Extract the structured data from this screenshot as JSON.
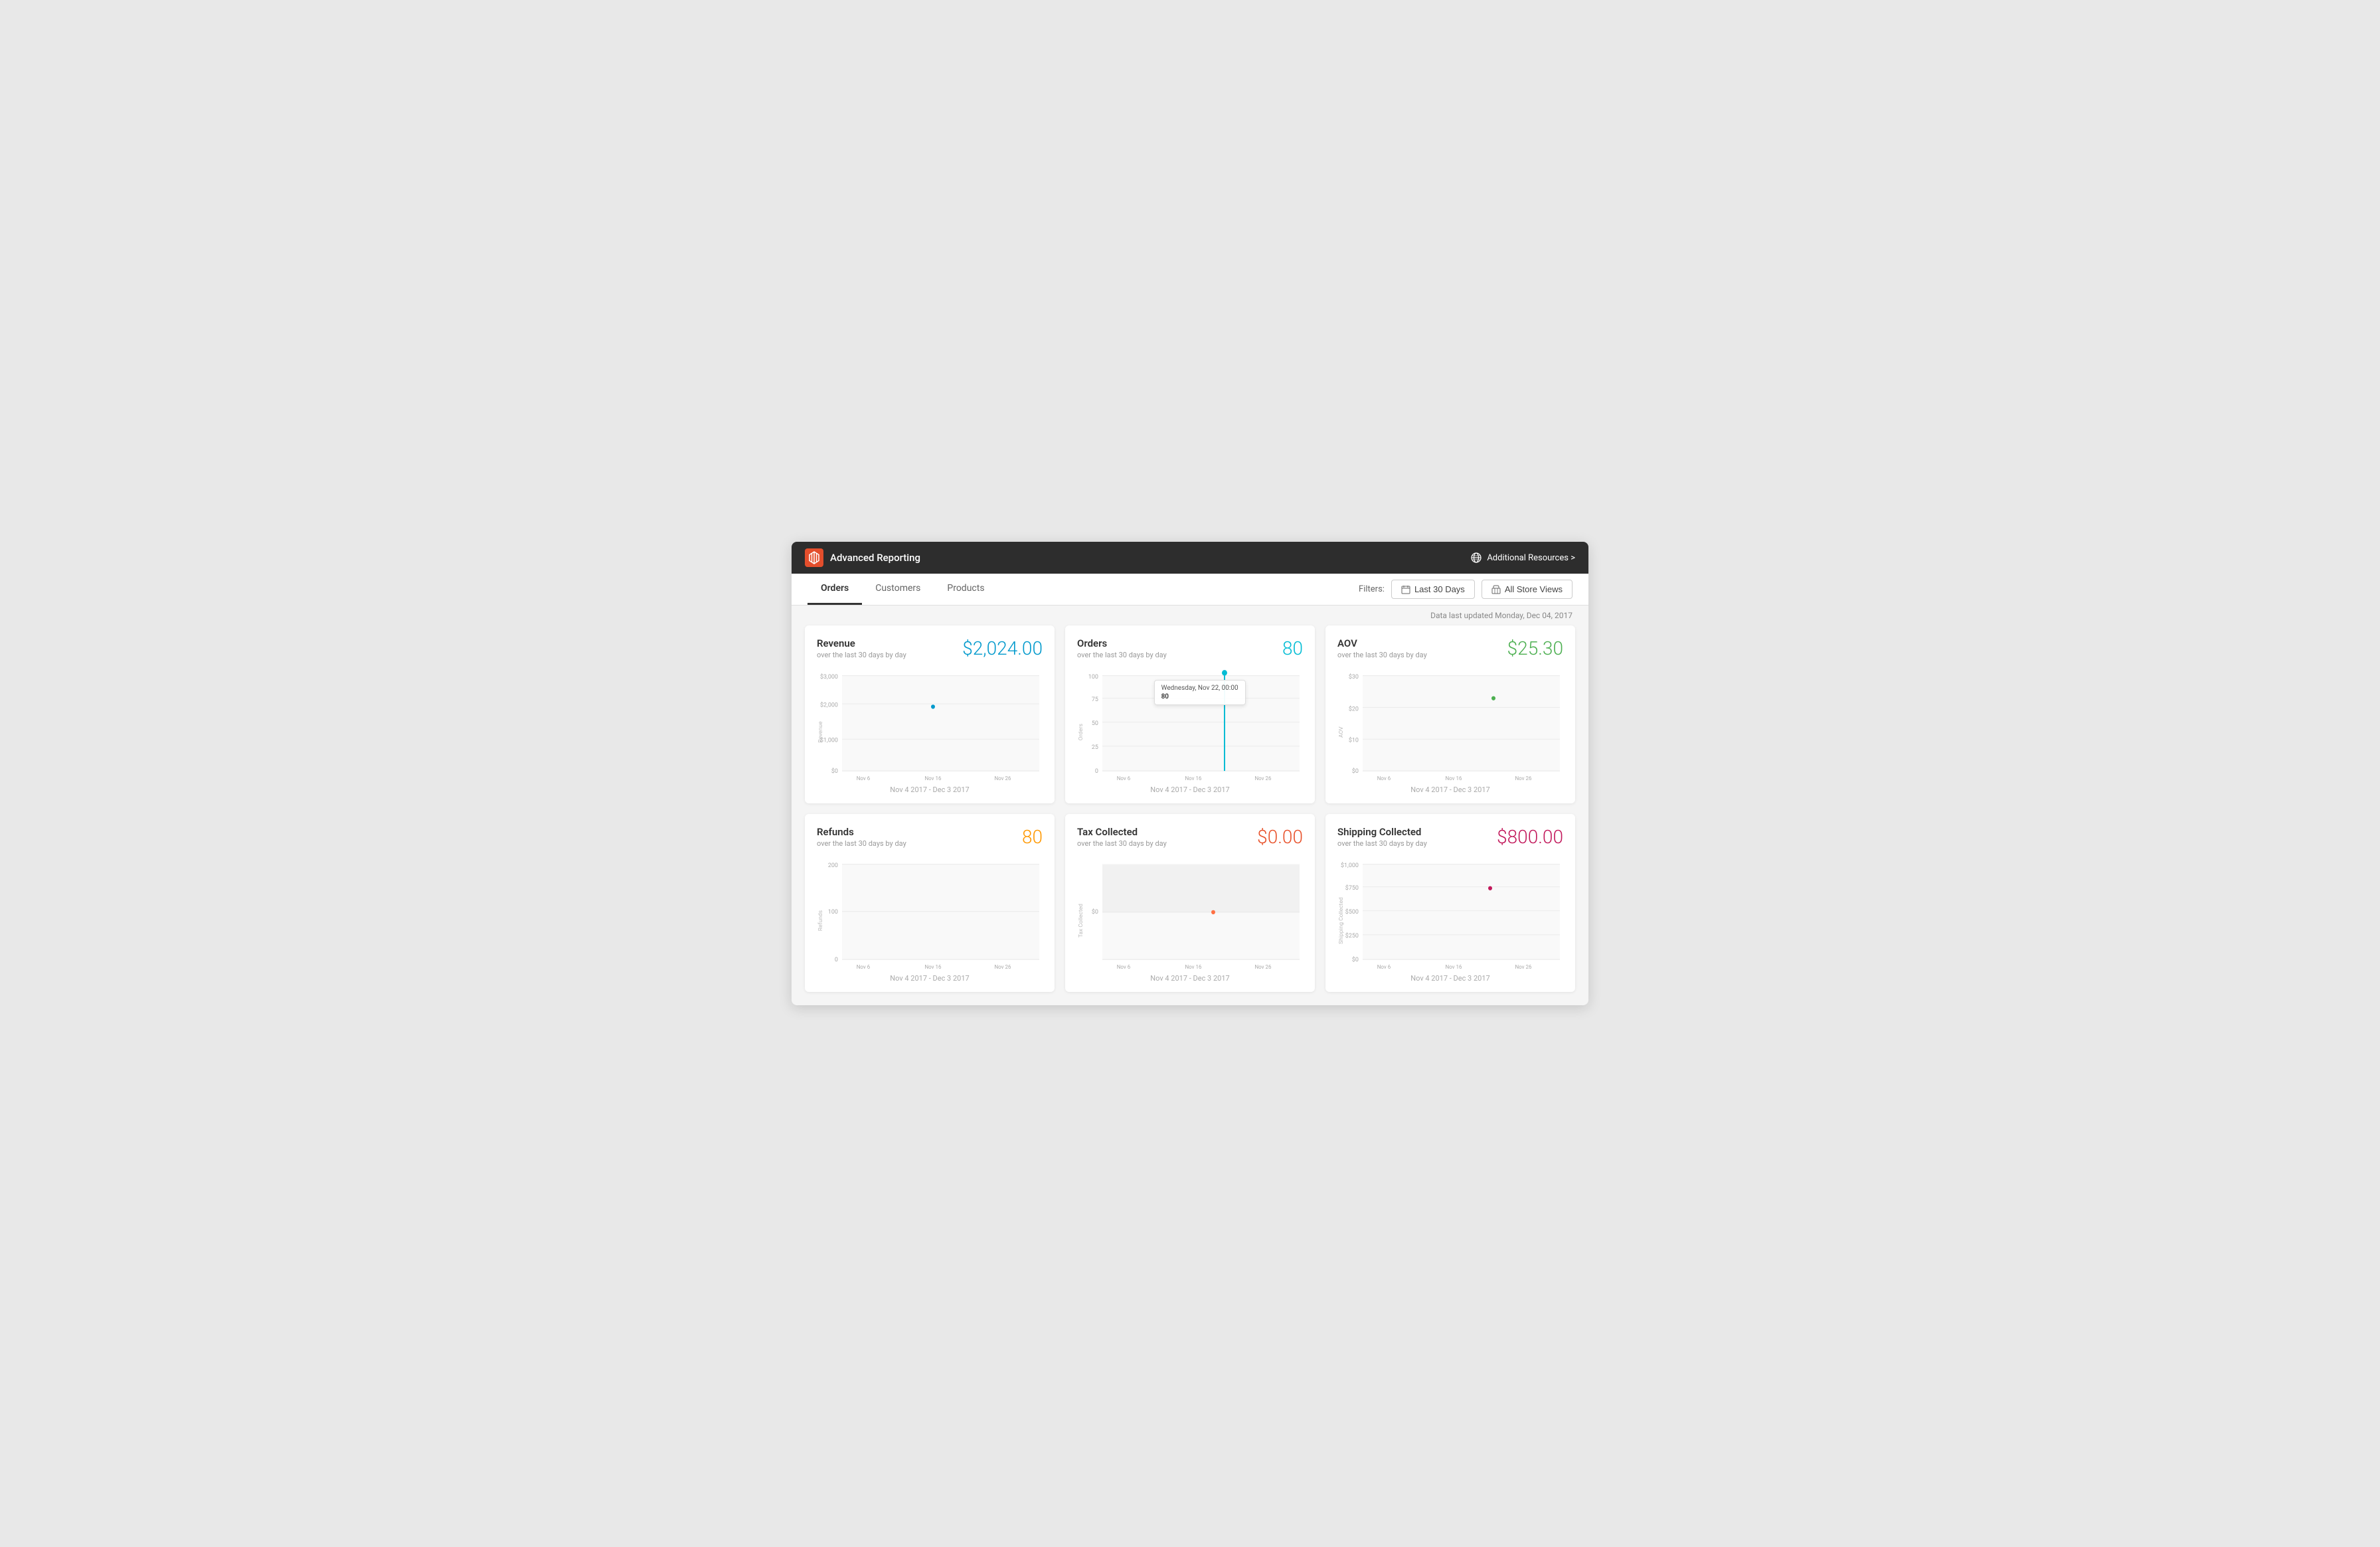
{
  "header": {
    "title": "Advanced Reporting",
    "additional_resources_label": "Additional Resources >"
  },
  "nav": {
    "tabs": [
      {
        "label": "Orders",
        "active": true
      },
      {
        "label": "Customers",
        "active": false
      },
      {
        "label": "Products",
        "active": false
      }
    ],
    "filters_label": "Filters:",
    "filter_date_label": "Last 30 Days",
    "filter_store_label": "All Store Views"
  },
  "data_updated": "Data last updated Monday, Dec 04, 2017",
  "cards": [
    {
      "id": "revenue",
      "title": "Revenue",
      "subtitle": "over the last 30 days by day",
      "value": "$2,024.00",
      "value_color": "value-blue",
      "date_range": "Nov 4 2017 - Dec 3 2017",
      "y_axis": [
        "$3,000",
        "$2,000",
        "$1,000",
        "$0"
      ],
      "x_axis": [
        "Nov 6",
        "Nov 16",
        "Nov 26"
      ]
    },
    {
      "id": "orders",
      "title": "Orders",
      "subtitle": "over the last 30 days by day",
      "value": "80",
      "value_color": "value-teal",
      "date_range": "Nov 4 2017 - Dec 3 2017",
      "y_axis": [
        "100",
        "75",
        "50",
        "25",
        "0"
      ],
      "x_axis": [
        "Nov 6",
        "Nov 16",
        "Nov 26"
      ],
      "has_tooltip": true,
      "tooltip_date": "Wednesday, Nov 22, 00:00",
      "tooltip_value": "80"
    },
    {
      "id": "aov",
      "title": "AOV",
      "subtitle": "over the last 30 days by day",
      "value": "$25.30",
      "value_color": "value-green",
      "date_range": "Nov 4 2017 - Dec 3 2017",
      "y_axis": [
        "$30",
        "$20",
        "$10",
        "$0"
      ],
      "x_axis": [
        "Nov 6",
        "Nov 16",
        "Nov 26"
      ]
    },
    {
      "id": "refunds",
      "title": "Refunds",
      "subtitle": "over the last 30 days by day",
      "value": "80",
      "value_color": "value-orange",
      "date_range": "Nov 4 2017 - Dec 3 2017",
      "y_axis": [
        "200",
        "100",
        "0"
      ],
      "x_axis": [
        "Nov 6",
        "Nov 16",
        "Nov 26"
      ]
    },
    {
      "id": "tax-collected",
      "title": "Tax Collected",
      "subtitle": "over the last 30 days by day",
      "value": "$0.00",
      "value_color": "value-red-orange",
      "date_range": "Nov 4 2017 - Dec 3 2017",
      "y_axis": [
        "$0"
      ],
      "x_axis": [
        "Nov 6",
        "Nov 16",
        "Nov 26"
      ]
    },
    {
      "id": "shipping-collected",
      "title": "Shipping Collected",
      "subtitle": "over the last 30 days by day",
      "value": "$800.00",
      "value_color": "value-magenta",
      "date_range": "Nov 4 2017 - Dec 3 2017",
      "y_axis": [
        "$1,000",
        "$750",
        "$500",
        "$250",
        "$0"
      ],
      "x_axis": [
        "Nov 6",
        "Nov 16",
        "Nov 26"
      ]
    }
  ]
}
